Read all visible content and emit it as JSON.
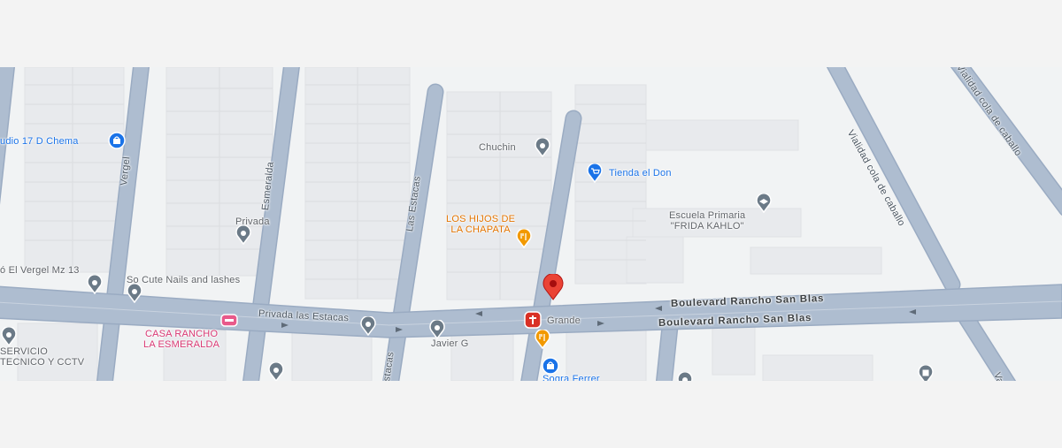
{
  "colors": {
    "background": "#f3f3f3",
    "map_land": "#f1f3f4",
    "block": "#e8eaed",
    "road": "#aebdd0",
    "road_edge": "#9aabc2",
    "pin_red": "#ea4335",
    "poi_gray": "#6b7a87",
    "poi_blue": "#1a73e8",
    "poi_orange": "#f29900",
    "poi_pink": "#e8598a",
    "poi_red": "#d93025"
  },
  "streets": {
    "vergel": "Vergel",
    "esmeralda": "Esmeralda",
    "las_estacas": "Las Estacas",
    "estacas": "Estacas",
    "vialidad": "Vialidad cola de caballo",
    "cola_de_caballo": "Vialidad cola de caballo",
    "privada_las_estacas": "Privada las Estacas",
    "boulevard_upper": "Boulevard Rancho San Blas",
    "boulevard_lower": "Boulevard Rancho San Blas",
    "va": "Va"
  },
  "places": {
    "chema": {
      "label": "udio 17 D Chema",
      "icon": "shopping-bag-icon"
    },
    "chuchin": {
      "label": "Chuchin",
      "icon": "place-pin-icon"
    },
    "tienda": {
      "label": "Tienda el Don",
      "icon": "shopping-cart-icon"
    },
    "escuela_line1": "Escuela Primaria",
    "escuela_line2": "\"FRIDA KAHLO\"",
    "hijos_line1": "LOS HIJOS DE",
    "hijos_line2": "LA CHAPATA",
    "privada": "Privada",
    "vergel_mz": "ó El Vergel Mz 13",
    "nails": "So Cute Nails and lashes",
    "rancho_line1": "CASA RANCHO",
    "rancho_line2": "LA ESMERALDA",
    "servicio_line1": "SERVICIO",
    "servicio_line2": "TECNICO Y CCTV",
    "javier": "Javier G",
    "grande": "Grande",
    "sogra": "Sogra Ferrer"
  }
}
